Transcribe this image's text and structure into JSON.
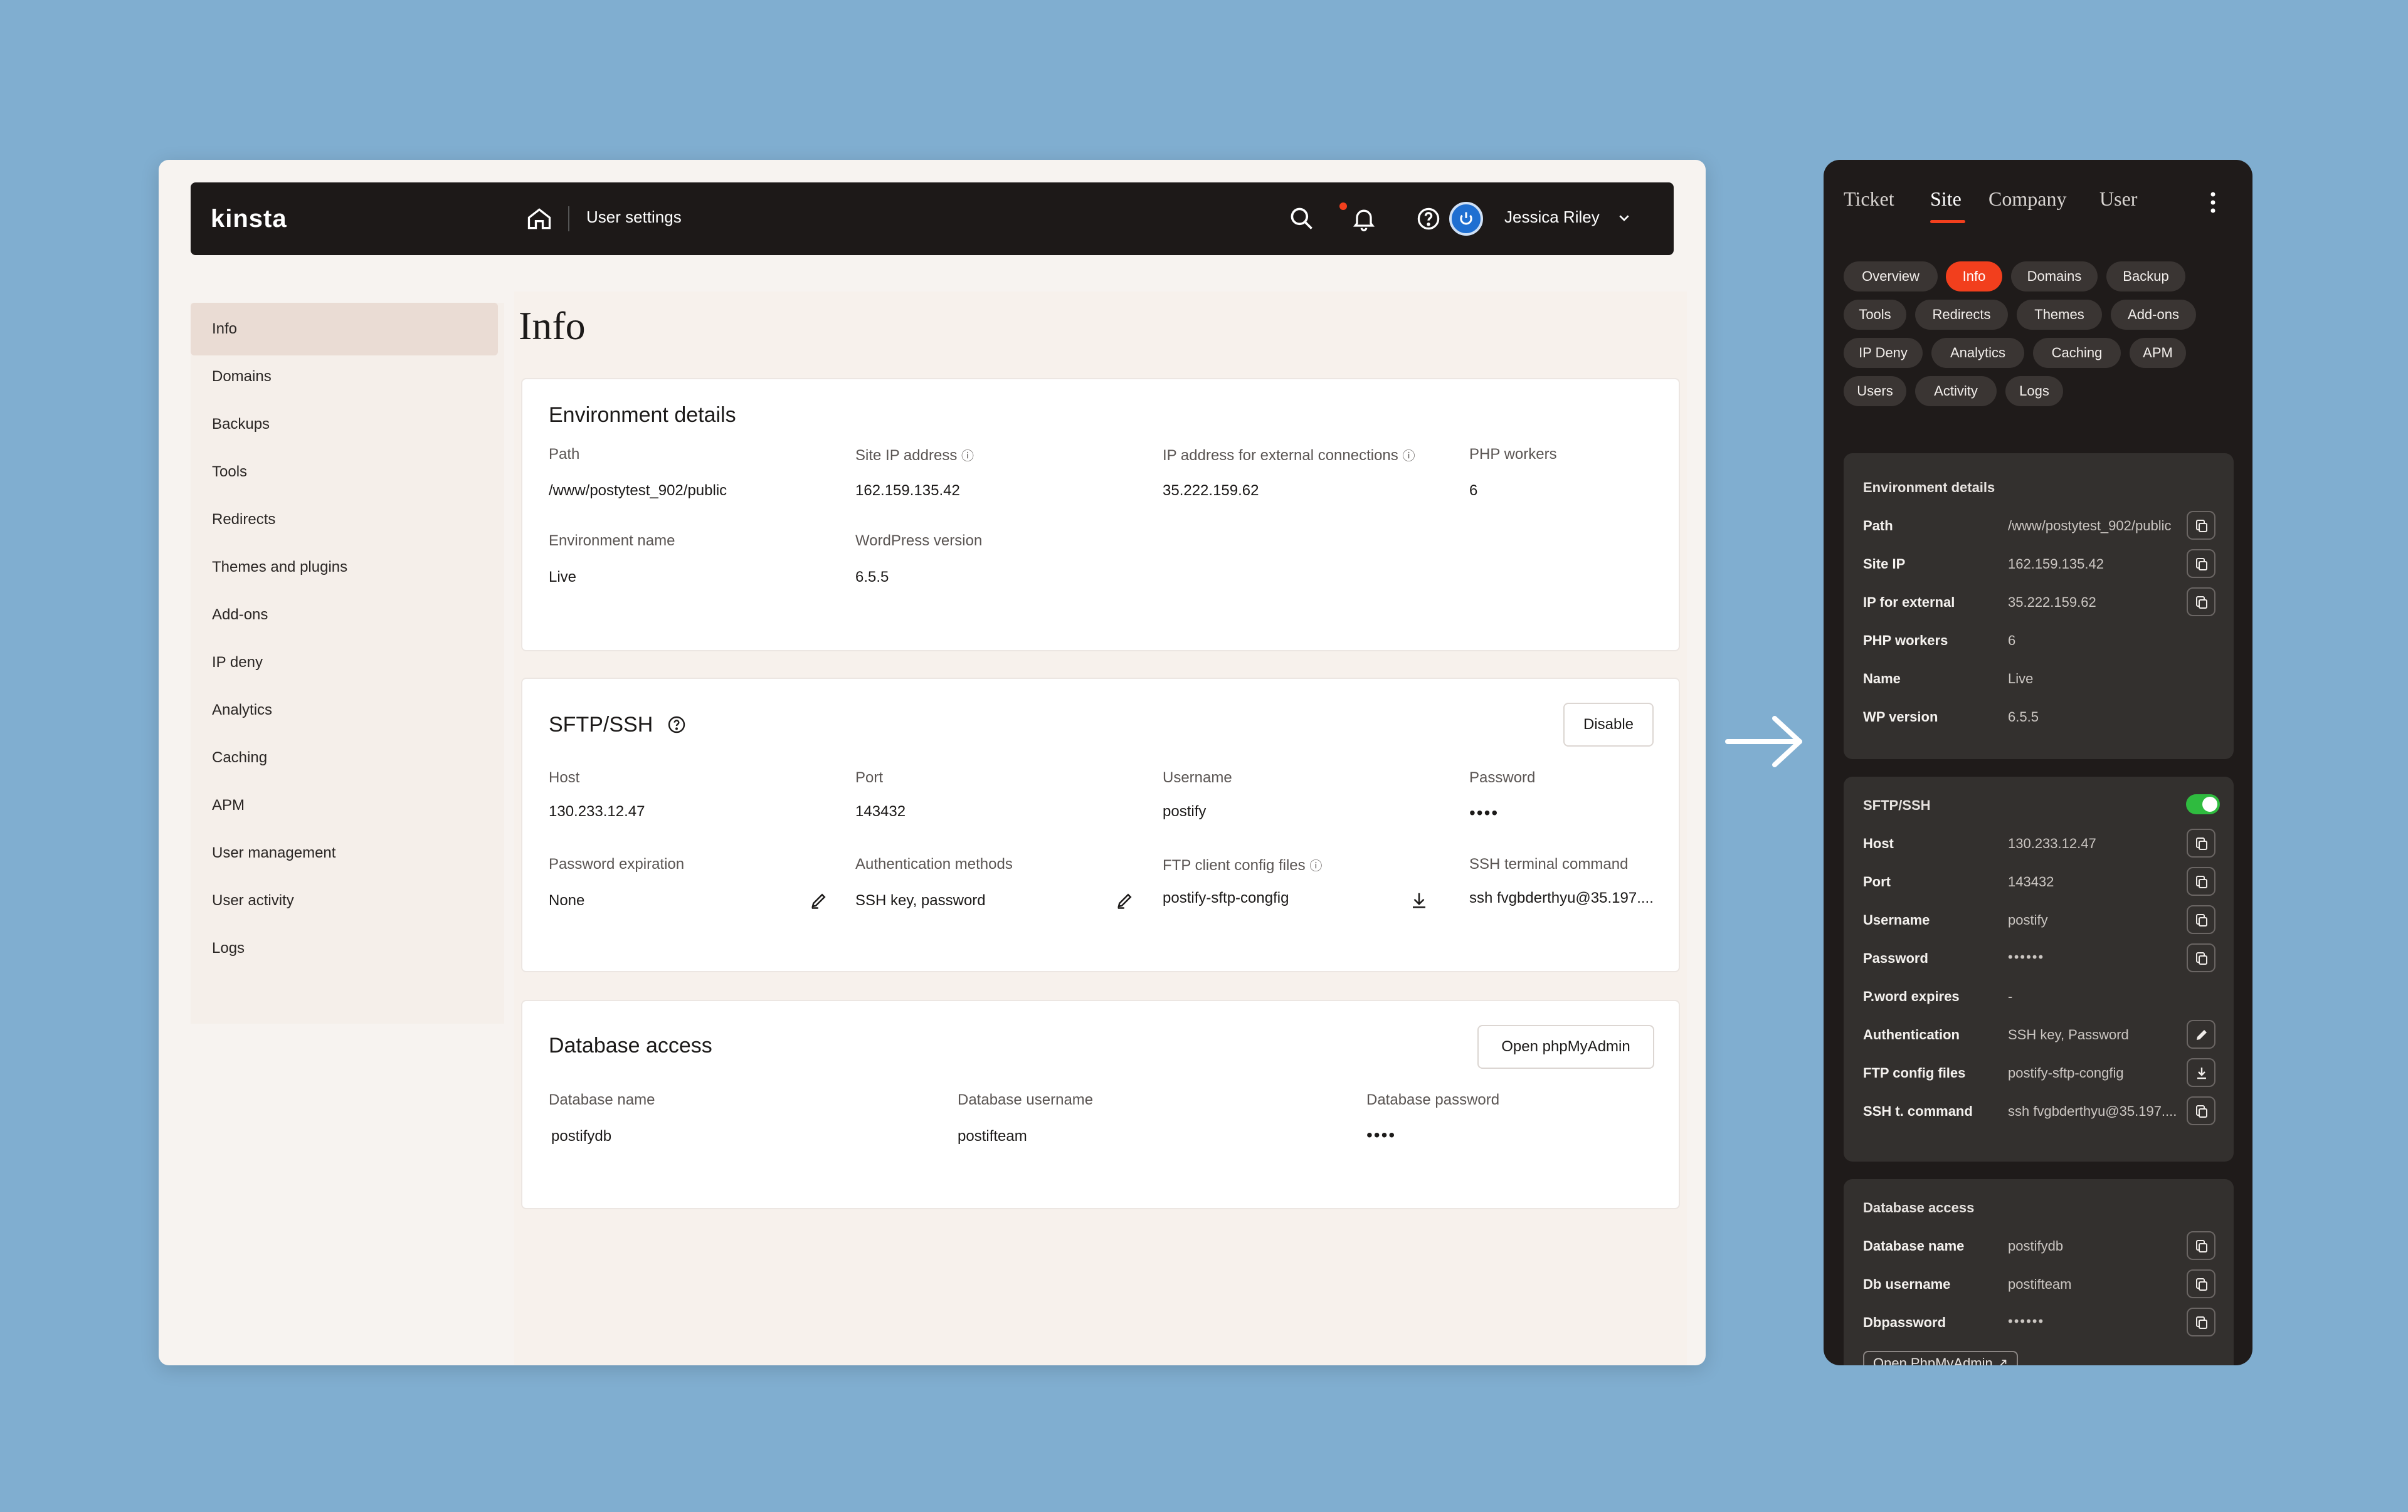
{
  "desktop": {
    "brand": "kinsta",
    "breadcrumb": "User settings",
    "user": {
      "name": "Jessica Riley"
    },
    "sidebar": [
      "Info",
      "Domains",
      "Backups",
      "Tools",
      "Redirects",
      "Themes and plugins",
      "Add-ons",
      "IP deny",
      "Analytics",
      "Caching",
      "APM",
      "User management",
      "User activity",
      "Logs"
    ],
    "page_title": "Info",
    "env": {
      "title": "Environment details",
      "path_label": "Path",
      "path": "/www/postytest_902/public",
      "site_ip_label": "Site IP address",
      "site_ip": "162.159.135.42",
      "ext_ip_label": "IP address for external connections",
      "ext_ip": "35.222.159.62",
      "php_label": "PHP workers",
      "php": "6",
      "envname_label": "Environment name",
      "envname": "Live",
      "wp_label": "WordPress version",
      "wp": "6.5.5"
    },
    "sftp": {
      "title": "SFTP/SSH",
      "disable_label": "Disable",
      "host_label": "Host",
      "host": "130.233.12.47",
      "port_label": "Port",
      "port": "143432",
      "user_label": "Username",
      "user": "postify",
      "pass_label": "Password",
      "pass": "••••",
      "exp_label": "Password expiration",
      "exp": "None",
      "auth_label": "Authentication methods",
      "auth": "SSH key, password",
      "ftp_label": "FTP client config files",
      "ftp": "postify-sftp-congfig",
      "ssh_label": "SSH terminal command",
      "ssh": "ssh fvgbderthyu@35.197...."
    },
    "db": {
      "title": "Database access",
      "open_label": "Open phpMyAdmin",
      "name_label": "Database name",
      "name": "postifydb",
      "user_label": "Database username",
      "user": "postifteam",
      "pass_label": "Database password",
      "pass": "••••"
    }
  },
  "mobile": {
    "tabs": [
      "Ticket",
      "Site",
      "Company",
      "User"
    ],
    "active_tab": "Site",
    "pills": [
      "Overview",
      "Info",
      "Domains",
      "Backup",
      "Tools",
      "Redirects",
      "Themes",
      "Add-ons",
      "IP Deny",
      "Analytics",
      "Caching",
      "APM",
      "Users",
      "Activity",
      "Logs"
    ],
    "active_pill": "Info",
    "env": {
      "title": "Environment details",
      "rows": [
        {
          "label": "Path",
          "value": "/www/postytest_902/public"
        },
        {
          "label": "Site IP",
          "value": "162.159.135.42"
        },
        {
          "label": "IP for external",
          "value": "35.222.159.62"
        },
        {
          "label": "PHP workers",
          "value": "6"
        },
        {
          "label": "Name",
          "value": "Live"
        },
        {
          "label": "WP version",
          "value": "6.5.5"
        }
      ]
    },
    "sftp": {
      "title": "SFTP/SSH",
      "enabled": true,
      "rows": [
        {
          "label": "Host",
          "value": "130.233.12.47"
        },
        {
          "label": "Port",
          "value": "143432"
        },
        {
          "label": "Username",
          "value": "postify"
        },
        {
          "label": "Password",
          "value": "••••••"
        },
        {
          "label": "P.word expires",
          "value": "-"
        },
        {
          "label": "Authentication",
          "value": "SSH key, Password"
        },
        {
          "label": "FTP config files",
          "value": "postify-sftp-congfig"
        },
        {
          "label": "SSH t. command",
          "value": "ssh fvgbderthyu@35.197...."
        }
      ]
    },
    "db": {
      "title": "Database access",
      "rows": [
        {
          "label": "Database name",
          "value": "postifydb"
        },
        {
          "label": "Db username",
          "value": "postifteam"
        },
        {
          "label": "Dbpassword",
          "value": "••••••"
        }
      ],
      "open_label": "Open PhpMyAdmin"
    }
  },
  "colors": {
    "accent": "#f23f1d",
    "dark": "#1d1918",
    "toggle_on": "#2fbb3f",
    "background": "#80aed0"
  }
}
